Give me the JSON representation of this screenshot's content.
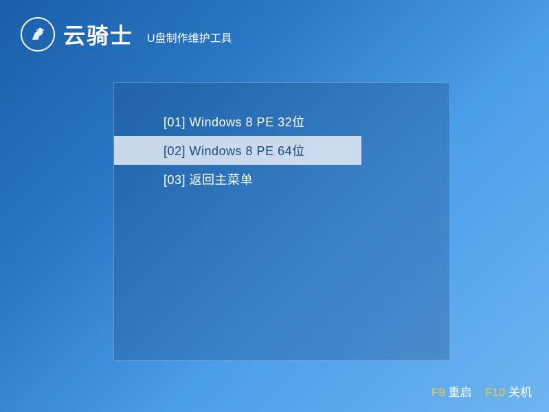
{
  "header": {
    "brand": "云骑士",
    "subtitle": "U盘制作维护工具"
  },
  "menu": {
    "items": [
      {
        "label": "[01] Windows 8 PE 32位",
        "selected": false
      },
      {
        "label": "[02] Windows 8 PE 64位",
        "selected": true
      },
      {
        "label": "[03] 返回主菜单",
        "selected": false
      }
    ]
  },
  "footer": {
    "key1": "F9",
    "label1": "重启",
    "key2": "F10",
    "label2": "关机"
  }
}
